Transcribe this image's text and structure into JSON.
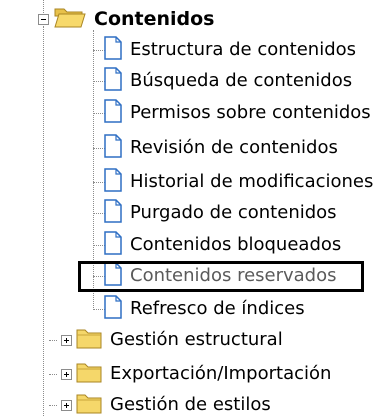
{
  "tree": {
    "root": {
      "label": "Contenidos",
      "icon": "folder-open-icon",
      "expanded": true
    },
    "children": [
      {
        "label": "Estructura de contenidos",
        "icon": "document-icon"
      },
      {
        "label": "Búsqueda de contenidos",
        "icon": "document-icon"
      },
      {
        "label": "Permisos sobre contenidos",
        "icon": "document-icon"
      },
      {
        "label": "Revisión de contenidos",
        "icon": "document-icon"
      },
      {
        "label": "Historial de modificaciones",
        "icon": "document-icon"
      },
      {
        "label": "Purgado de contenidos",
        "icon": "document-icon"
      },
      {
        "label": "Contenidos bloqueados",
        "icon": "document-icon"
      },
      {
        "label": "Contenidos reservados",
        "icon": "document-icon",
        "highlighted": true
      },
      {
        "label": "Refresco de índices",
        "icon": "document-icon"
      }
    ],
    "folders": [
      {
        "label": "Gestión estructural",
        "icon": "folder-icon",
        "expanded": false
      },
      {
        "label": "Exportación/Importación",
        "icon": "folder-icon",
        "expanded": false
      },
      {
        "label": "Gestión de estilos",
        "icon": "folder-icon",
        "expanded": false
      }
    ]
  },
  "colors": {
    "folder": "#f5d76a",
    "folder_dark": "#c9a53a",
    "document": "#ffffff",
    "document_border": "#2f6fc4",
    "highlight_border": "#000000"
  }
}
